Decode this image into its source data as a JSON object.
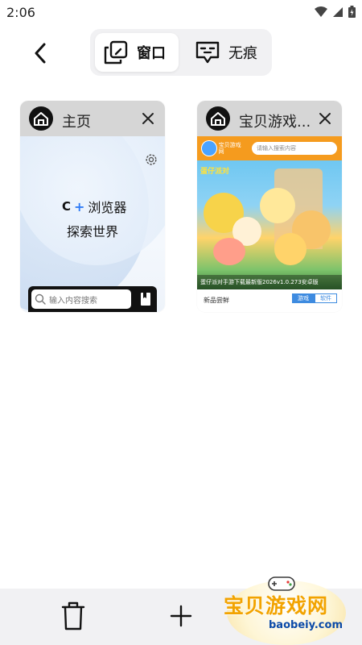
{
  "status_bar": {
    "time": "2:06"
  },
  "mode_switch": {
    "windows_label": "窗口",
    "incognito_label": "无痕",
    "active": "windows"
  },
  "tabs": [
    {
      "title": "主页",
      "preview": {
        "brand": "浏览器",
        "slogan": "探索世界",
        "search_placeholder": "输入内容搜索"
      }
    },
    {
      "title": "宝贝游戏...",
      "preview": {
        "site_logo": "宝贝游戏网",
        "search_placeholder": "请输入搜索内容",
        "game_tag": "蛋仔派对",
        "banner_caption": "蛋仔派对手游下载最新版2026v1.0.273安卓版",
        "section_label": "新品尝鲜",
        "pill_games": "游戏",
        "pill_software": "软件"
      }
    }
  ],
  "watermark": {
    "text": "宝贝游戏网",
    "url": "baobeiy.com"
  },
  "colors": {
    "accent": "#2f7cf6",
    "card_header": "#d6d6d6",
    "bottom_bar": "#f1f1f3",
    "site_orange": "#f59b1e"
  },
  "icons": {
    "back": "chevron-left-icon",
    "windows": "windows-stack-icon",
    "incognito": "incognito-mask-icon",
    "home_logo": "home-icon",
    "close": "close-icon",
    "delete": "trash-icon",
    "add": "plus-icon"
  }
}
